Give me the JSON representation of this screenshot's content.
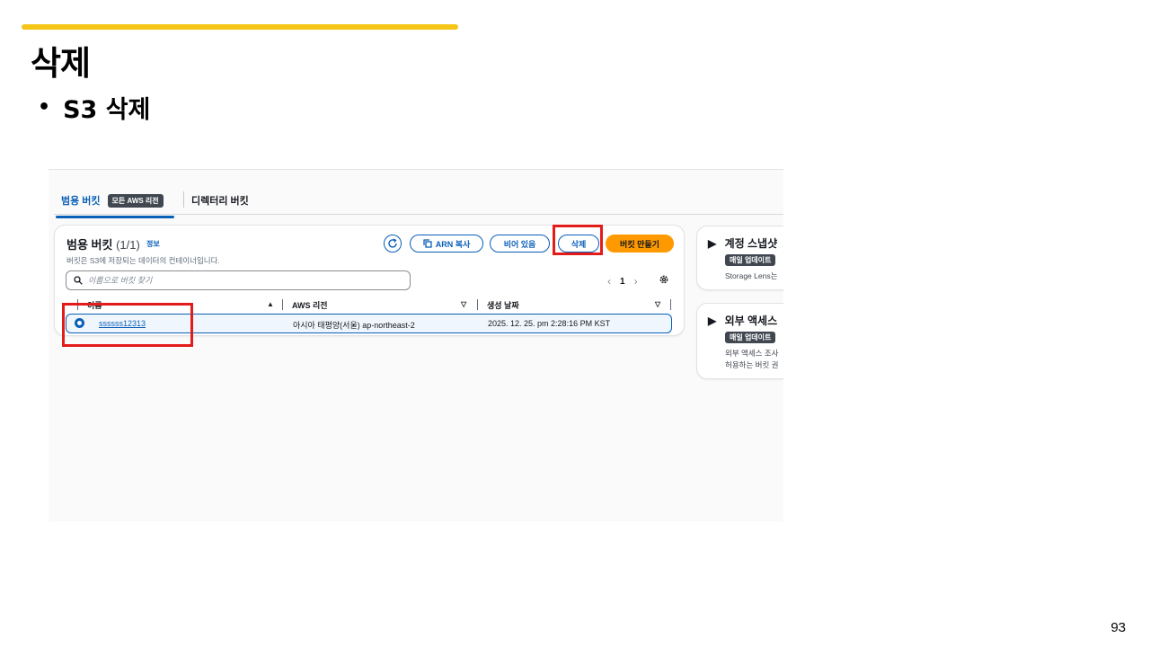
{
  "slide": {
    "title": "삭제",
    "bullet": "S3 삭제",
    "page_number": "93"
  },
  "colors": {
    "accent_bar": "#f5c518",
    "highlight": "#e31b1b",
    "aws_blue": "#0a5fb8",
    "create_button": "#ff9900"
  },
  "tabs": {
    "general_label": "범용 버킷",
    "general_badge": "모든 AWS 리전",
    "directory_label": "디렉터리 버킷"
  },
  "bucket_panel": {
    "title": "범용 버킷",
    "count": "(1/1)",
    "info": "정보",
    "description": "버킷은 S3에 저장되는 데이터의 컨테이너입니다.",
    "buttons": {
      "refresh_icon": "refresh-icon",
      "copy_arn": "ARN 복사",
      "empty": "비어 있음",
      "delete": "삭제",
      "create": "버킷 만들기"
    },
    "search_placeholder": "이름으로 버킷 찾기",
    "pagination": {
      "current_page": "1"
    },
    "columns": [
      "이름",
      "AWS 리전",
      "생성 날짜"
    ],
    "rows": [
      {
        "name": "ssssss12313",
        "region": "아시아 태평양(서울) ap-northeast-2",
        "created": "2025. 12. 25. pm 2:28:16 PM KST",
        "selected": true
      }
    ]
  },
  "side_panels": [
    {
      "title": "계정 스냅샷",
      "badge": "매일 업데이트",
      "text": [
        "Storage Lens는"
      ]
    },
    {
      "title": "외부 액세스",
      "badge": "매일 업데이트",
      "text": [
        "외부 액세스 조사",
        "허용하는 버킷 권"
      ]
    }
  ]
}
